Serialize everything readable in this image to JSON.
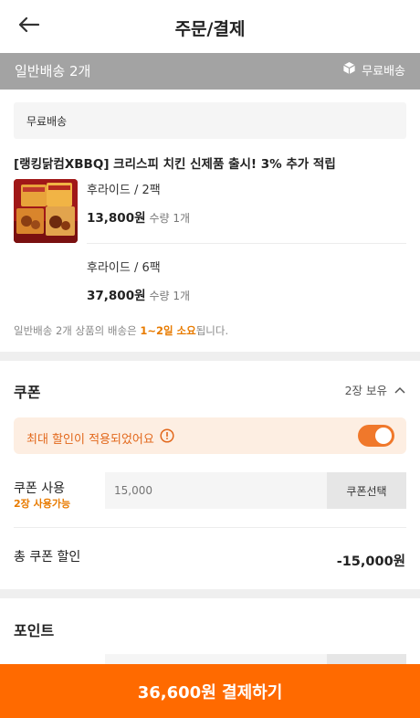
{
  "header": {
    "title": "주문/결제",
    "back_icon": "arrow-left-icon"
  },
  "shipping": {
    "label": "일반배송 2개",
    "free_label": "무료배송",
    "box_icon": "package-icon"
  },
  "order": {
    "free_shipping_box": "무료배송",
    "product_title": "[랭킹닭컴XBBQ] 크리스피 치킨 신제품 출시! 3% 추가 적립",
    "options": [
      {
        "name": "후라이드 / 2팩",
        "price": "13,800원",
        "qty": "수량 1개"
      },
      {
        "name": "후라이드 / 6팩",
        "price": "37,800원",
        "qty": "수량 1개"
      }
    ],
    "delivery_note": {
      "prefix": "일반배송 2개 상품의 배송은 ",
      "highlight": "1~2일 소요",
      "suffix": "됩니다."
    }
  },
  "coupon": {
    "title": "쿠폰",
    "count": "2장 보유",
    "banner_text": "최대 할인이 적용되었어요",
    "max_discount_on": true,
    "use_label": "쿠폰 사용",
    "available": "2장 사용가능",
    "amount_placeholder": "15,000",
    "select_button": "쿠폰선택",
    "total_label": "총 쿠폰 할인",
    "total_value": "-15,000원"
  },
  "point": {
    "title": "포인트"
  },
  "pay_button": "36,600원 결제하기",
  "colors": {
    "accent": "#ff6a00",
    "shipping_bar": "#a3a3a3",
    "highlight": "#e87b00"
  }
}
